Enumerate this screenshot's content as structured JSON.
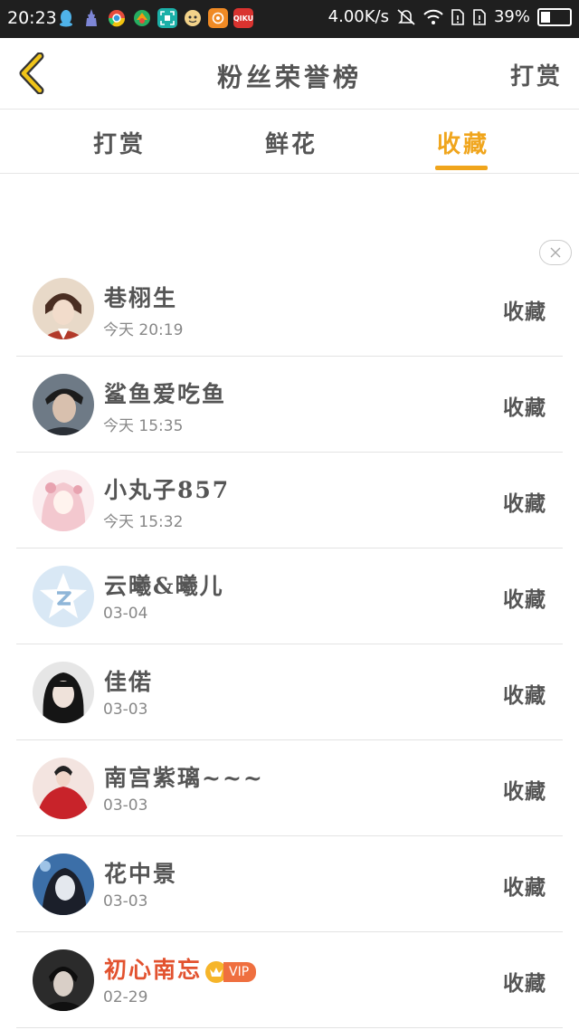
{
  "status_bar": {
    "time": "20:23",
    "net_speed": "4.00K/s",
    "battery": "39%",
    "battery_level": 0.39,
    "app_icons": [
      "qq-icon",
      "tower-icon",
      "chrome-icon",
      "map-icon",
      "scan-icon",
      "face-icon",
      "mail-icon",
      "qiku-icon"
    ],
    "qiku_label": "QIKU"
  },
  "header": {
    "title": "粉丝荣誉榜",
    "action": "打赏"
  },
  "tabs": [
    {
      "label": "打赏",
      "active": false
    },
    {
      "label": "鲜花",
      "active": false
    },
    {
      "label": "收藏",
      "active": true
    }
  ],
  "colors": {
    "accent": "#f0a51c",
    "vip_name": "#e2522f"
  },
  "fans": [
    {
      "name": "巷栩生",
      "time": "今天 20:19",
      "action": "收藏",
      "vip": false
    },
    {
      "name": "鲨鱼爱吃鱼",
      "time": "今天 15:35",
      "action": "收藏",
      "vip": false
    },
    {
      "name": "小丸子857",
      "time": "今天 15:32",
      "action": "收藏",
      "vip": false
    },
    {
      "name": "云曦&曦儿",
      "time": "03-04",
      "action": "收藏",
      "vip": false
    },
    {
      "name": "佳偌",
      "time": "03-03",
      "action": "收藏",
      "vip": false
    },
    {
      "name": "南宫紫璃~~~",
      "time": "03-03",
      "action": "收藏",
      "vip": false
    },
    {
      "name": "花中景",
      "time": "03-03",
      "action": "收藏",
      "vip": false
    },
    {
      "name": "初心南忘",
      "time": "02-29",
      "action": "收藏",
      "vip": true,
      "vip_label": "VIP"
    }
  ]
}
